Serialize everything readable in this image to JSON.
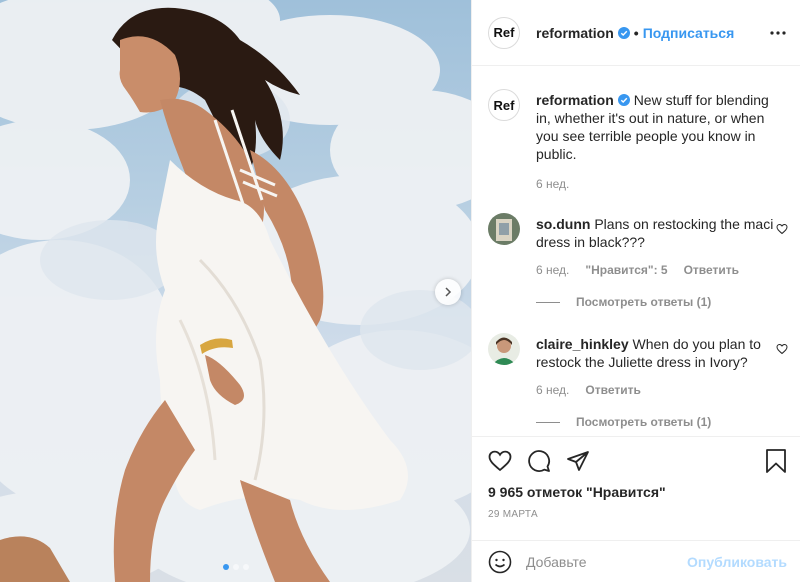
{
  "header": {
    "avatar_text": "Ref",
    "username": "reformation",
    "separator": "•",
    "follow_label": "Подписаться"
  },
  "caption": {
    "avatar_text": "Ref",
    "username": "reformation",
    "text": "New stuff for blending in, whether it's out in nature, or when you see terrible people you know in public.",
    "time": "6 нед."
  },
  "comments": [
    {
      "username": "so.dunn",
      "text": "Plans on restocking the maci dress in black???",
      "time": "6 нед.",
      "likes_label": "\"Нравится\": 5",
      "reply_label": "Ответить",
      "view_replies": "Посмотреть ответы (1)"
    },
    {
      "username": "claire_hinkley",
      "text": "When do you plan to restock the Juliette dress in Ivory?",
      "time": "6 нед.",
      "reply_label": "Ответить",
      "view_replies": "Посмотреть ответы (1)"
    }
  ],
  "actions": {
    "likes_count": "9 965 отметок \"Нравится\"",
    "date": "29 МАРТА"
  },
  "add_comment": {
    "placeholder": "Добавьте",
    "publish_label": "Опубликовать"
  },
  "carousel": {
    "count": 3,
    "active_index": 0
  },
  "colors": {
    "accent": "#3897f0",
    "text": "#262626",
    "muted": "#8e8e8e",
    "publish_disabled": "#b3dbff"
  }
}
